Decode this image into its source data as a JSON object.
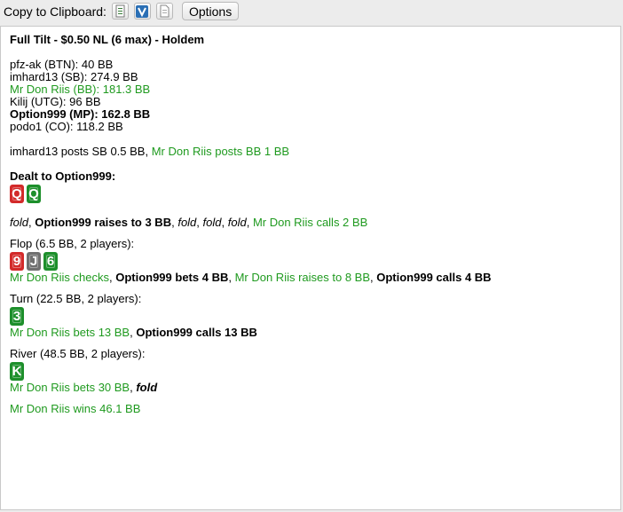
{
  "toolbar": {
    "copy_label": "Copy to Clipboard:",
    "icons": [
      "copy-html-icon",
      "copy-forum-icon",
      "copy-text-icon"
    ],
    "options_label": "Options"
  },
  "hand": {
    "title": "Full Tilt - $0.50 NL (6 max) - Holdem",
    "players": [
      "pfz-ak (BTN): 40 BB",
      "imhard13 (SB): 274.9 BB",
      "Mr Don Riis (BB): 181.3 BB",
      "Kilij (UTG): 96 BB",
      "Option999 (MP): 162.8 BB",
      "podo1 (CO): 118.2 BB"
    ],
    "blinds": {
      "sb": "imhard13 posts SB 0.5 BB",
      "sep": ", ",
      "bb": "Mr Don Riis posts BB 1 BB"
    },
    "dealt": {
      "label": "Dealt to Option999:",
      "cards": [
        "Q",
        "Q"
      ]
    },
    "preflop": {
      "a1": "fold",
      "a2": "Option999 raises to 3 BB",
      "a3": "fold",
      "a4": "fold",
      "a5": "fold",
      "a6": "Mr Don Riis calls 2 BB",
      "sep": ", "
    },
    "flop": {
      "label": "Flop (6.5 BB, 2 players):",
      "cards": [
        "9",
        "J",
        "6"
      ],
      "a1": "Mr Don Riis checks",
      "a2": "Option999 bets 4 BB",
      "a3": "Mr Don Riis raises to 8 BB",
      "a4": "Option999 calls 4 BB",
      "sep": ", "
    },
    "turn": {
      "label": "Turn (22.5 BB, 2 players):",
      "cards": [
        "3"
      ],
      "a1": "Mr Don Riis bets 13 BB",
      "a2": "Option999 calls 13 BB",
      "sep": ", "
    },
    "river": {
      "label": "River (48.5 BB, 2 players):",
      "cards": [
        "K"
      ],
      "a1": "Mr Don Riis bets 30 BB",
      "a2": "fold",
      "sep": ", "
    },
    "result": "Mr Don Riis wins 46.1 BB"
  },
  "colors": {
    "hero_action": "#000000",
    "villain_action": "#1f9a1f",
    "card_hearts": "#d32a2a",
    "card_clubs": "#1d8f2b",
    "card_spades": "#707070"
  }
}
